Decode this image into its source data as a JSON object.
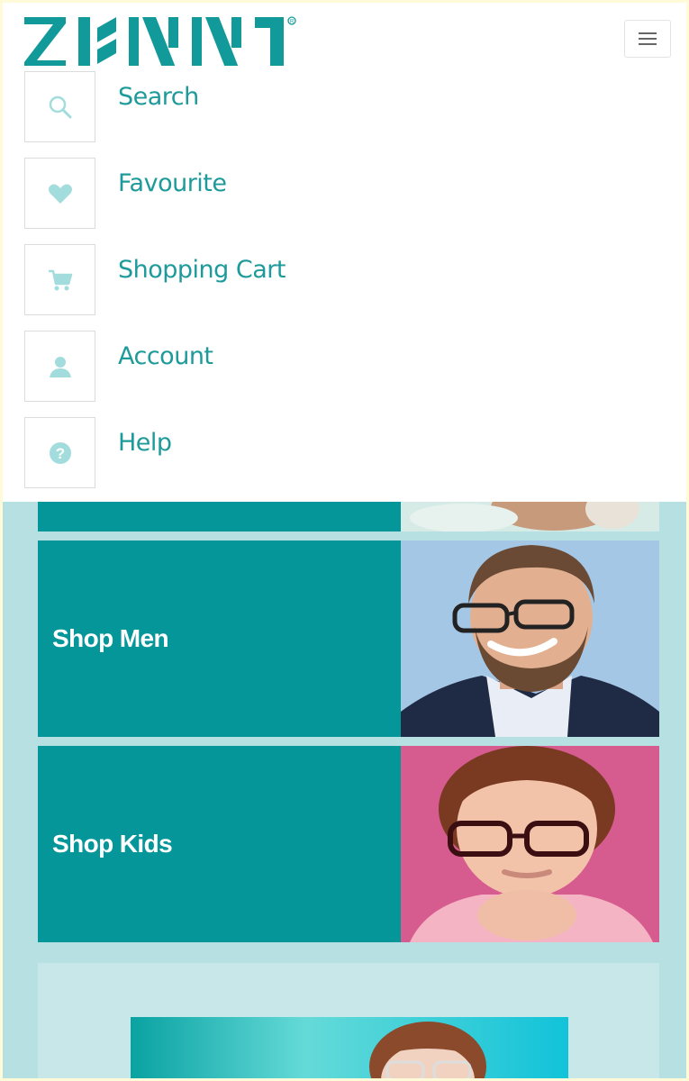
{
  "brand": {
    "name": "ZENNI",
    "registered_mark": "®",
    "color": "#12999a"
  },
  "header": {
    "menu_icon": "hamburger-icon"
  },
  "menu": {
    "items": [
      {
        "label": "Search",
        "icon": "search-icon"
      },
      {
        "label": "Favourite",
        "icon": "heart-icon"
      },
      {
        "label": "Shopping Cart",
        "icon": "cart-icon"
      },
      {
        "label": "Account",
        "icon": "user-icon"
      },
      {
        "label": "Help",
        "icon": "help-icon"
      }
    ],
    "icon_color": "#a3dcdc",
    "label_color": "#1f9a9a"
  },
  "cards": [
    {
      "title": "Shop Men",
      "photo_bg": "#a4c7e6"
    },
    {
      "title": "Shop Kids",
      "photo_bg": "#d65b8e"
    }
  ],
  "colors": {
    "page_bg": "#b7e0e2",
    "card_teal": "#05969a",
    "bottom_section": "#c8e7e8"
  }
}
